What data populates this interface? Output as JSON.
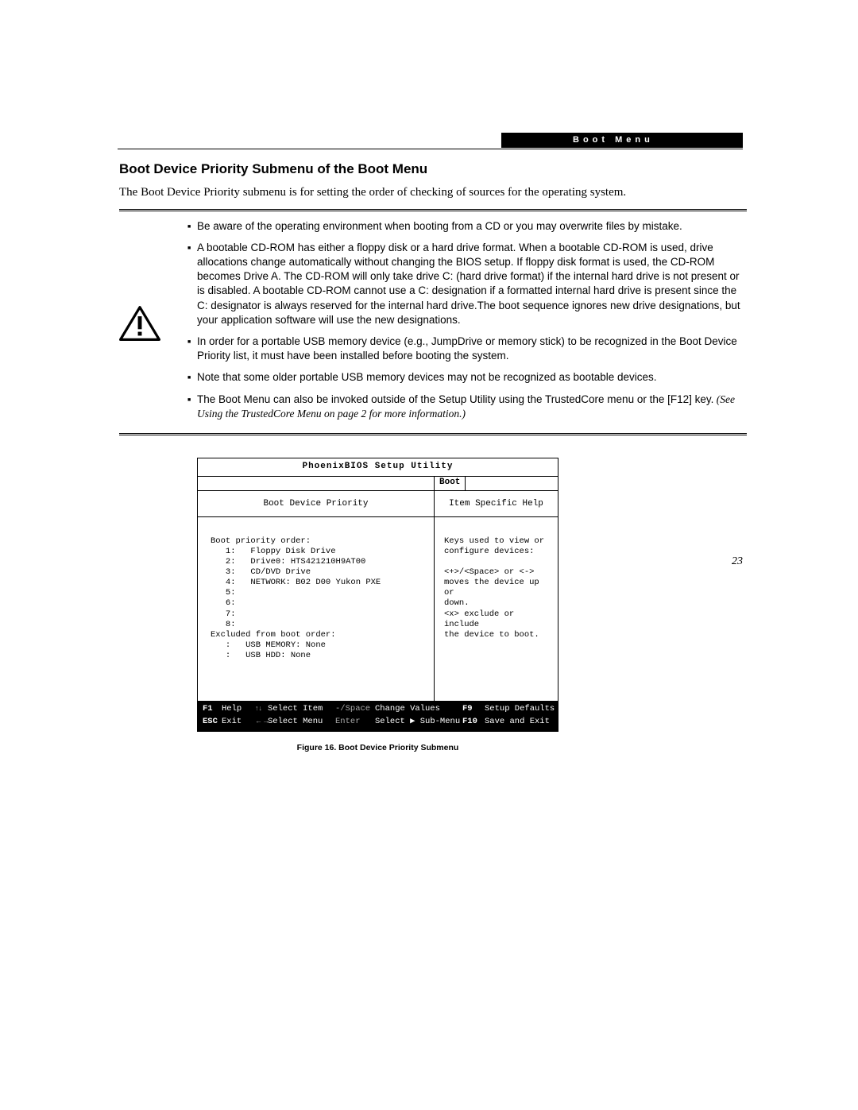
{
  "header": {
    "tab_label": "Boot Menu"
  },
  "section_title": "Boot Device Priority Submenu of the Boot Menu",
  "intro": "The Boot Device Priority submenu is for setting the order of checking of sources for the operating system.",
  "notes": [
    "Be aware of the operating environment when booting from a CD or you may overwrite files by mistake.",
    "A bootable CD-ROM has either a floppy disk or a hard drive format. When a bootable CD-ROM is used, drive allocations change automatically without changing the BIOS setup. If floppy disk format is used, the CD-ROM becomes Drive A. The CD-ROM will only take drive C: (hard drive format) if the internal hard drive is not present or is disabled. A bootable CD-ROM cannot use a C: designation if a formatted internal hard drive is present since the C: designator is always reserved for the internal hard drive.The boot sequence ignores new drive designations, but your application software will use the new designations.",
    "In order for a portable USB memory device (e.g., JumpDrive or memory stick) to be recognized in the Boot Device Priority list, it must have been installed before booting the system.",
    "Note that some older portable USB memory devices may not be recognized as bootable devices.",
    "The Boot Menu can also be invoked outside of the Setup Utility using the TrustedCore menu or the [F12] key."
  ],
  "notes_tail_italic": " (See Using the TrustedCore Menu on page 2 for more information.)",
  "bios": {
    "title": "PhoenixBIOS Setup Utility",
    "tab": "Boot",
    "left_heading": "Boot Device Priority",
    "right_heading": "Item Specific Help",
    "priority_label": "Boot priority order:",
    "priority_items": [
      "1:   Floppy Disk Drive",
      "2:   Drive0: HTS421210H9AT00",
      "3:   CD/DVD Drive",
      "4:   NETWORK: B02 D00 Yukon PXE",
      "5:",
      "6:",
      "7:",
      "8:"
    ],
    "excluded_label": "Excluded from boot order:",
    "excluded_items": [
      ":   USB MEMORY: None",
      ":   USB HDD: None"
    ],
    "help_text": "Keys used to view or\nconfigure devices:\n\n<+>/<Space> or <->\nmoves the device up or\ndown.\n<x> exclude or include\nthe device to boot.",
    "footer": {
      "r1c1": "F1",
      "r1c2": "Help",
      "r1c3": "↑↓",
      "r1c4": "Select Item",
      "r1c5": "-/Space",
      "r1c6": "Change Values",
      "r1c7": "F9",
      "r1c8": "Setup Defaults",
      "r2c1": "ESC",
      "r2c2": "Exit",
      "r2c3": "←→",
      "r2c4": "Select Menu",
      "r2c5": "Enter",
      "r2c6": "Select ▶ Sub-Menu",
      "r2c7": "F10",
      "r2c8": "Save and Exit"
    }
  },
  "figure_caption": "Figure 16.  Boot Device Priority Submenu",
  "page_number": "23"
}
